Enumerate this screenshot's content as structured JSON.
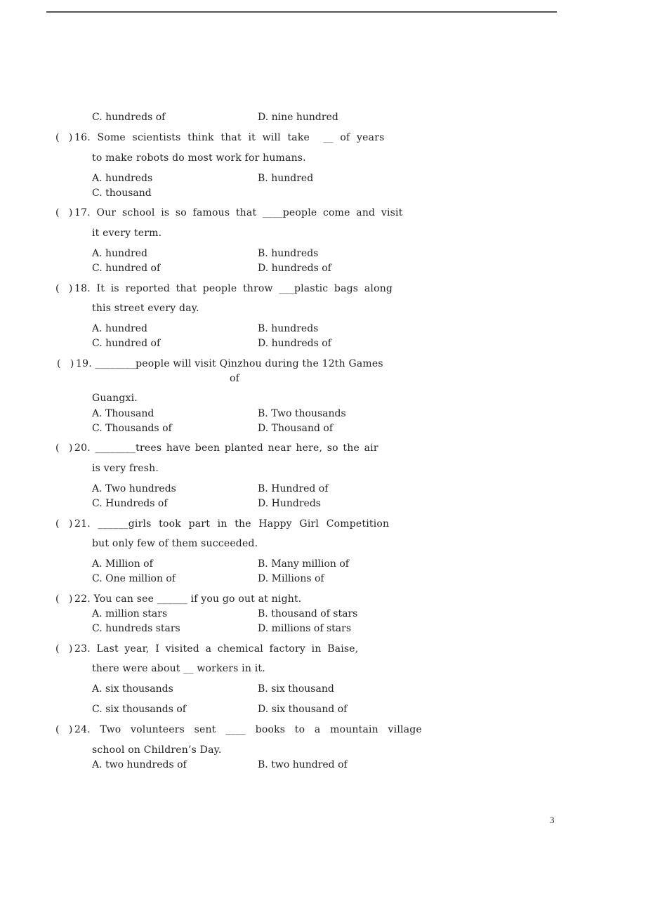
{
  "page": {
    "page_number": "3"
  },
  "carryover": {
    "options": [
      {
        "letter": "C.",
        "text": "hundreds of"
      },
      {
        "letter": "D.",
        "text": "nine hundred"
      }
    ]
  },
  "questions": [
    {
      "number": "16",
      "stem_line1": "Some scientists think that it will take",
      "blank": "__",
      "stem_line1_after": "of years",
      "stem_line2": "to make robots do most work for humans.",
      "options": [
        {
          "letter": "A.",
          "text": "hundreds"
        },
        {
          "letter": "B.",
          "text": "hundred"
        },
        {
          "letter": "C.",
          "text": "thousand"
        }
      ]
    },
    {
      "number": "17",
      "stem_line1": "Our school is so famous that",
      "blank": "____",
      "stem_line1_after": "people come and visit",
      "stem_line2": "it every term.",
      "options": [
        {
          "letter": "A.",
          "text": "hundred"
        },
        {
          "letter": "B.",
          "text": "hundreds"
        },
        {
          "letter": "C.",
          "text": "hundred of"
        },
        {
          "letter": "D.",
          "text": "hundreds of"
        }
      ]
    },
    {
      "number": "18",
      "stem_line1": "It is reported that people throw",
      "blank": "___",
      "stem_line1_after": "plastic bags along",
      "stem_line2": "this street every day.",
      "options": [
        {
          "letter": "A.",
          "text": "hundred"
        },
        {
          "letter": "B.",
          "text": "hundreds"
        },
        {
          "letter": "C.",
          "text": "hundred of"
        },
        {
          "letter": "D.",
          "text": "hundreds of"
        }
      ]
    },
    {
      "number": "19",
      "stem_line1": "",
      "blank": "________",
      "stem_line1_after": "people will visit Qinzhou during the 12th Games",
      "stem_line1b": "of",
      "stem_line2": "Guangxi.",
      "options": [
        {
          "letter": "A.",
          "text": "Thousand"
        },
        {
          "letter": "B.",
          "text": "Two thousands"
        },
        {
          "letter": "C.",
          "text": "Thousands of"
        },
        {
          "letter": "D.",
          "text": "Thousand of"
        }
      ]
    },
    {
      "number": "20",
      "stem_line1": "",
      "blank": "________",
      "stem_line1_after": "trees have been planted near here, so the air",
      "stem_line2": "is very fresh.",
      "options": [
        {
          "letter": "A.",
          "text": "Two hundreds"
        },
        {
          "letter": "B.",
          "text": "Hundred of"
        },
        {
          "letter": "C.",
          "text": "Hundreds of"
        },
        {
          "letter": "D.",
          "text": "Hundreds"
        }
      ]
    },
    {
      "number": "21",
      "stem_line1": "",
      "blank": "______",
      "stem_line1_after": "girls took part in the Happy Girl Competition",
      "stem_line2": "but only few of them succeeded.",
      "options": [
        {
          "letter": "A.",
          "text": "Million of"
        },
        {
          "letter": "B.",
          "text": "Many million of"
        },
        {
          "letter": "C.",
          "text": "One million of"
        },
        {
          "letter": "D.",
          "text": "Millions of"
        }
      ]
    },
    {
      "number": "22",
      "stem_line1": "You can see",
      "blank": "______",
      "stem_line1_after": "if you go out at night.",
      "options": [
        {
          "letter": "A.",
          "text": "million stars"
        },
        {
          "letter": "B.",
          "text": "thousand of stars"
        },
        {
          "letter": "C.",
          "text": "hundreds stars"
        },
        {
          "letter": "D.",
          "text": "millions of stars"
        }
      ]
    },
    {
      "number": "23",
      "stem_line1": "Last year, I visited a chemical factory in Baise,",
      "stem_line2_before": "there were about",
      "blank": "__",
      "stem_line2_after": "workers in it.",
      "options": [
        {
          "letter": "A.",
          "text": "six thousands"
        },
        {
          "letter": "B.",
          "text": "six thousand"
        },
        {
          "letter": "C.",
          "text": "six thousands of"
        },
        {
          "letter": "D.",
          "text": "six thousand of"
        }
      ]
    },
    {
      "number": "24",
      "stem_line1": "Two volunteers sent",
      "blank": "____",
      "stem_line1_after": "books to a mountain village",
      "stem_line2": "school on Children’s Day.",
      "options": [
        {
          "letter": "A.",
          "text": "two hundreds of"
        },
        {
          "letter": "B.",
          "text": "two hundred of"
        }
      ]
    }
  ]
}
